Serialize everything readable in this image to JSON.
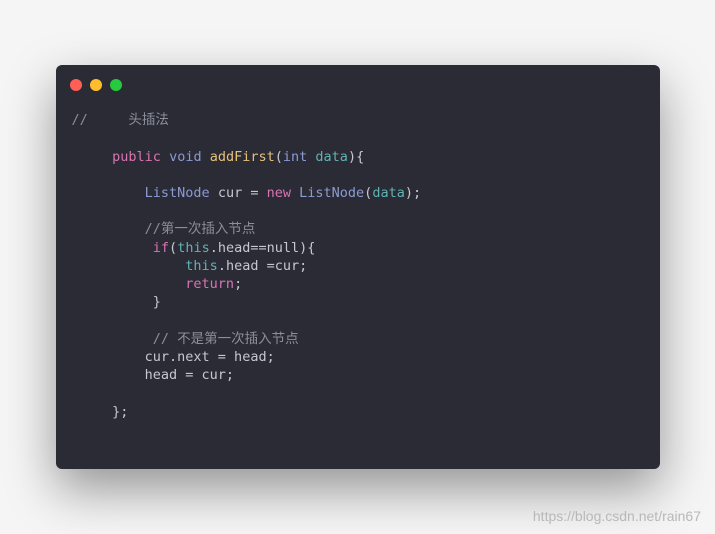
{
  "code": {
    "line1_slashes": "//",
    "line1_comment": "头插法",
    "line2_public": "public",
    "line2_void": "void",
    "line2_fn": "addFirst",
    "line2_int": "int",
    "line2_data": "data",
    "line3_type1": "ListNode",
    "line3_var": "cur",
    "line3_new": "new",
    "line3_type2": "ListNode",
    "line3_arg": "data",
    "line4_comment": "//第一次插入节点",
    "line5_if": "if",
    "line5_this": "this",
    "line5_rest": ".head==null){",
    "line6_this": "this",
    "line6_rest": ".head =cur;",
    "line7_return": "return",
    "line8_brace": "}",
    "line9_comment": "// 不是第一次插入节点",
    "line10": "cur.next = head;",
    "line11": "head = cur;",
    "line12": "};"
  },
  "watermark": "https://blog.csdn.net/rain67"
}
